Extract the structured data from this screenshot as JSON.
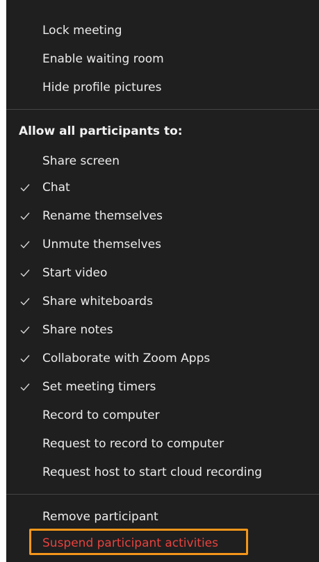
{
  "menu": {
    "top_items": [
      {
        "label": "Lock meeting",
        "checked": false
      },
      {
        "label": "Enable waiting room",
        "checked": false
      },
      {
        "label": "Hide profile pictures",
        "checked": false
      }
    ],
    "section_header": "Allow all participants to:",
    "permission_items": [
      {
        "label": "Share screen",
        "checked": false
      },
      {
        "label": "Chat",
        "checked": true
      },
      {
        "label": "Rename themselves",
        "checked": true
      },
      {
        "label": "Unmute themselves",
        "checked": true
      },
      {
        "label": "Start video",
        "checked": true
      },
      {
        "label": "Share whiteboards",
        "checked": true
      },
      {
        "label": "Share notes",
        "checked": true
      },
      {
        "label": "Collaborate with Zoom Apps",
        "checked": true
      },
      {
        "label": "Set meeting timers",
        "checked": true
      },
      {
        "label": "Record to computer",
        "checked": false
      },
      {
        "label": "Request to record to computer",
        "checked": false
      },
      {
        "label": "Request host to start cloud recording",
        "checked": false
      }
    ],
    "bottom_items": [
      {
        "label": "Remove participant"
      },
      {
        "label": "Suspend participant activities"
      }
    ],
    "colors": {
      "background": "#1f1f1f",
      "text": "#ececec",
      "danger_text": "#e8423e",
      "highlight_border": "#f4961a",
      "divider": "#454545"
    }
  }
}
